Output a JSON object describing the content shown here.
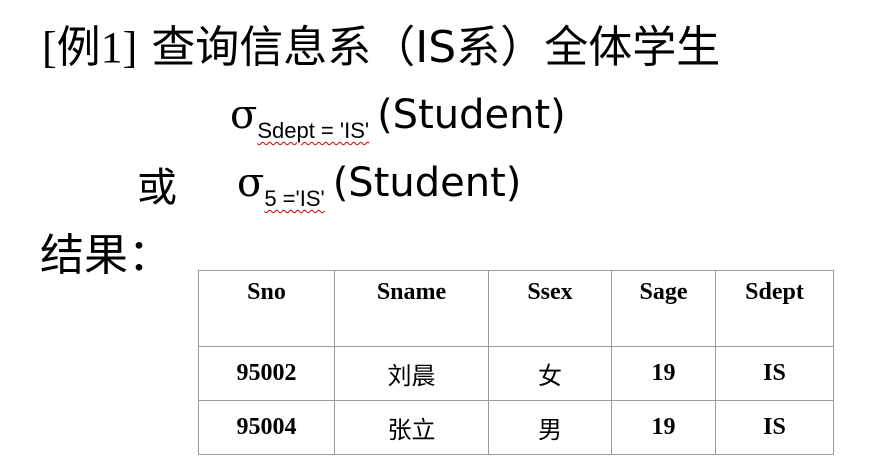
{
  "title": {
    "label": "[例1]",
    "text": "查询信息系（IS系）全体学生"
  },
  "formula1": {
    "operator": "σ",
    "condition": "Sdept = 'IS'",
    "relation": "(Student)"
  },
  "or_word": "或",
  "formula2": {
    "operator": "σ",
    "condition": "5 ='IS'",
    "relation": "(Student)"
  },
  "result_label": "结果：",
  "table": {
    "headers": [
      "Sno",
      "Sname",
      "Ssex",
      "Sage",
      "Sdept"
    ],
    "rows": [
      [
        "95002",
        "刘晨",
        "女",
        "19",
        "IS"
      ],
      [
        "95004",
        "张立",
        "男",
        "19",
        "IS"
      ]
    ]
  }
}
